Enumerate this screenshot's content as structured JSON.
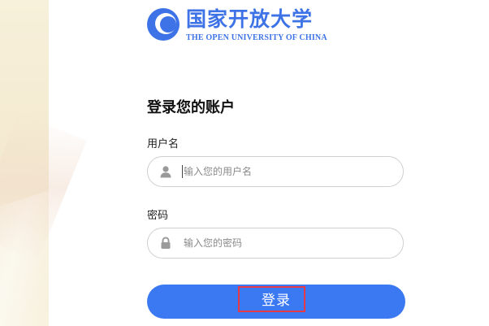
{
  "logo": {
    "title_cn": "国家开放大学",
    "title_en": "THE OPEN UNIVERSITY OF CHINA",
    "icon": "ouc-logo-icon"
  },
  "form": {
    "title": "登录您的账户",
    "username": {
      "label": "用户名",
      "placeholder": "输入您的用户名",
      "icon": "user-icon"
    },
    "password": {
      "label": "密码",
      "placeholder": "输入您的密码",
      "icon": "lock-icon"
    },
    "login_label": "登录"
  },
  "colors": {
    "brand": "#3d73e6",
    "button": "#3b79f3",
    "highlight": "#e63946",
    "side_background": "#f5ecd6"
  }
}
